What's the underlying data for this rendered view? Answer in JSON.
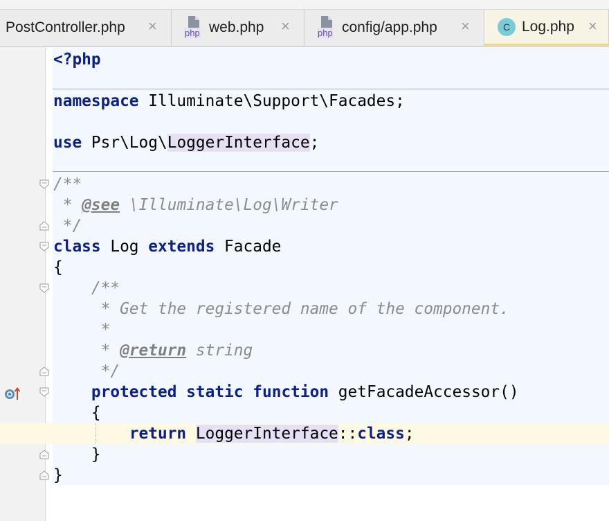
{
  "tabs": [
    {
      "label": "PostController.php",
      "icon": "none",
      "active": false
    },
    {
      "label": "web.php",
      "icon": "php-file-icon",
      "active": false
    },
    {
      "label": "config/app.php",
      "icon": "php-file-icon",
      "active": false
    },
    {
      "label": "Log.php",
      "icon": "class-icon",
      "active": true
    }
  ],
  "icons": {
    "php_badge": "php",
    "class_badge": "C",
    "close": "×"
  },
  "colors": {
    "keyword": "#0b2088",
    "doc_comment": "#8c8c8c",
    "current_line": "#fdf9e3",
    "editor_bg": "#f3f7fe"
  },
  "code": {
    "l1": {
      "open_tag": "<?php"
    },
    "l3": {
      "kw": "namespace",
      "rest": " Illuminate\\Support\\Facades;"
    },
    "l5": {
      "kw": "use",
      "pre": " Psr\\Log\\",
      "hl": "LoggerInterface",
      "post": ";"
    },
    "l7": {
      "text": "/**"
    },
    "l8": {
      "pre": " * ",
      "tag": "@see",
      "post": " \\Illuminate\\Log\\Writer"
    },
    "l9": {
      "text": " */"
    },
    "l10": {
      "kw1": "class",
      "mid": " Log ",
      "kw2": "extends",
      "rest": " Facade"
    },
    "l11": {
      "text": "{"
    },
    "l12": {
      "indent": "    ",
      "text": "/**"
    },
    "l13": {
      "indent": "    ",
      "text": " * Get the registered name of the component."
    },
    "l14": {
      "indent": "    ",
      "text": " *"
    },
    "l15": {
      "indent": "    ",
      "pre": " * ",
      "tag": "@return",
      "post": " string"
    },
    "l16": {
      "indent": "    ",
      "text": " */"
    },
    "l17": {
      "indent": "    ",
      "kw1": "protected",
      "kw2": "static",
      "kw3": "function",
      "rest": " getFacadeAccessor()"
    },
    "l18": {
      "indent": "    ",
      "text": "{"
    },
    "l19": {
      "indent": "        ",
      "kw": "return",
      "hl": "LoggerInterface",
      "sep": "::",
      "kw2": "class",
      "end": ";"
    },
    "l20": {
      "indent": "    ",
      "text": "}"
    },
    "l21": {
      "text": "}"
    }
  }
}
